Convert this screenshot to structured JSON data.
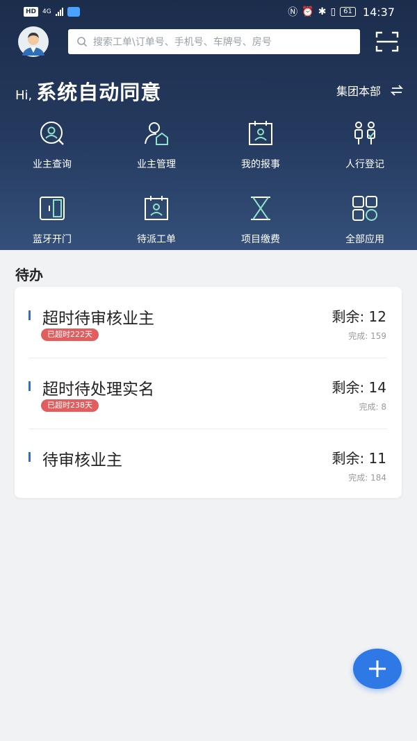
{
  "status_bar": {
    "left_chip": "HD",
    "network": "4G",
    "time": "14:37",
    "battery": "61"
  },
  "search": {
    "placeholder": "搜索工单\\订单号、手机号、车牌号、房号"
  },
  "greeting": {
    "hi": "Hi,",
    "name": "系统自动同意"
  },
  "org": {
    "label": "集团本部"
  },
  "quick_actions": [
    {
      "label": "业主查询",
      "icon": "owner-search-icon"
    },
    {
      "label": "业主管理",
      "icon": "owner-manage-icon"
    },
    {
      "label": "我的报事",
      "icon": "my-report-icon"
    },
    {
      "label": "人行登记",
      "icon": "pedestrian-register-icon"
    },
    {
      "label": "蓝牙开门",
      "icon": "bluetooth-door-icon"
    },
    {
      "label": "待派工单",
      "icon": "pending-dispatch-icon"
    },
    {
      "label": "项目缴费",
      "icon": "hourglass-icon"
    },
    {
      "label": "全部应用",
      "icon": "all-apps-icon"
    }
  ],
  "todo": {
    "title": "待办",
    "items": [
      {
        "title": "超时待审核业主",
        "badge": "已超时222天",
        "remain": "剩余: 12",
        "done": "完成: 159"
      },
      {
        "title": "超时待处理实名",
        "badge": "已超时238天",
        "remain": "剩余: 14",
        "done": "完成: 8"
      },
      {
        "title": "待审核业主",
        "badge": "",
        "remain": "剩余: 11",
        "done": "完成: 184"
      }
    ]
  },
  "colors": {
    "header_dark": "#1c2d4c",
    "icon_accent": "#8fe3c8",
    "badge_red": "#e25d5d",
    "fab_blue": "#2e79e6"
  }
}
